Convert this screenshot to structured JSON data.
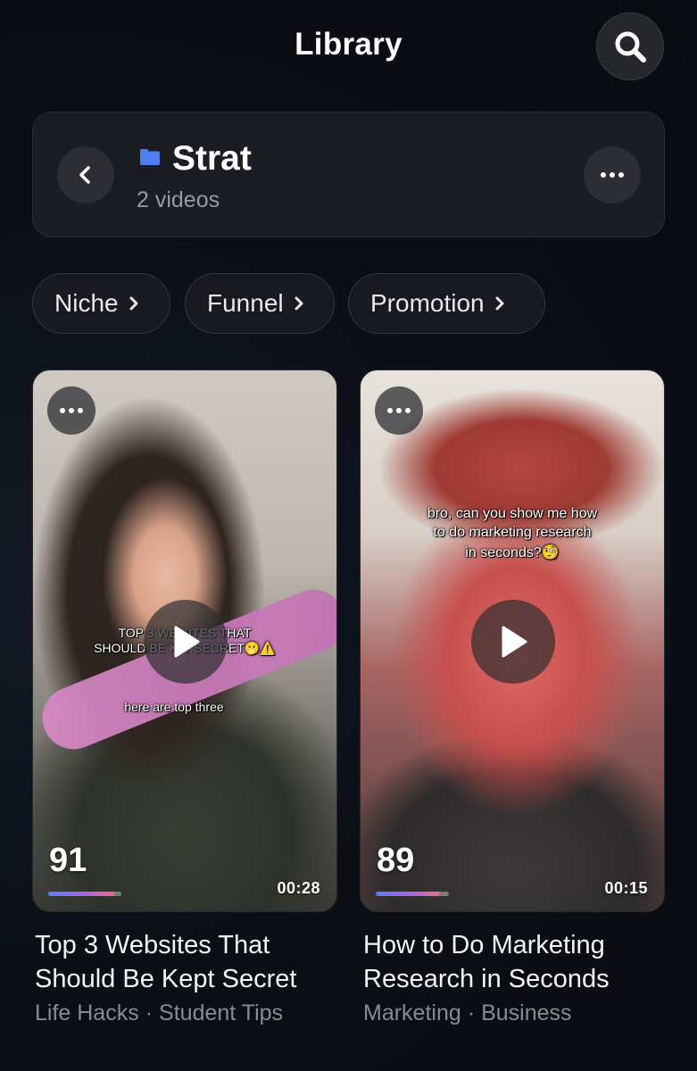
{
  "header": {
    "title": "Library",
    "search_icon": "search-icon"
  },
  "folder": {
    "name": "Strat",
    "count_label": "2 videos",
    "icon": "folder-icon",
    "icon_color": "#4f7df3"
  },
  "filters": [
    {
      "label": "Niche"
    },
    {
      "label": "Funnel"
    },
    {
      "label": "Promotion"
    }
  ],
  "videos": [
    {
      "score": "91",
      "duration": "00:28",
      "progress": 0.9,
      "caption_lines": [
        "TOP 3 WE SITES THAT",
        "SHOULD BE K  T SECRET🫢⚠️"
      ],
      "caption_sub": "here are top three",
      "title": "Top 3 Websites That Should Be Kept Secret",
      "tags": [
        "Life Hacks",
        "Student Tips"
      ]
    },
    {
      "score": "89",
      "duration": "00:15",
      "progress": 0.88,
      "caption_lines": [
        "bro, can you show me how",
        "to do marketing research",
        "in seconds?🧐"
      ],
      "title": "How to Do Marketing Research in Seconds",
      "tags": [
        "Marketing",
        "Business"
      ]
    }
  ],
  "colors": {
    "background": "#0a0b10",
    "card": "#1c1d22",
    "accent_gradient": [
      "#5b7bff",
      "#a265e6",
      "#f06b8b"
    ]
  }
}
